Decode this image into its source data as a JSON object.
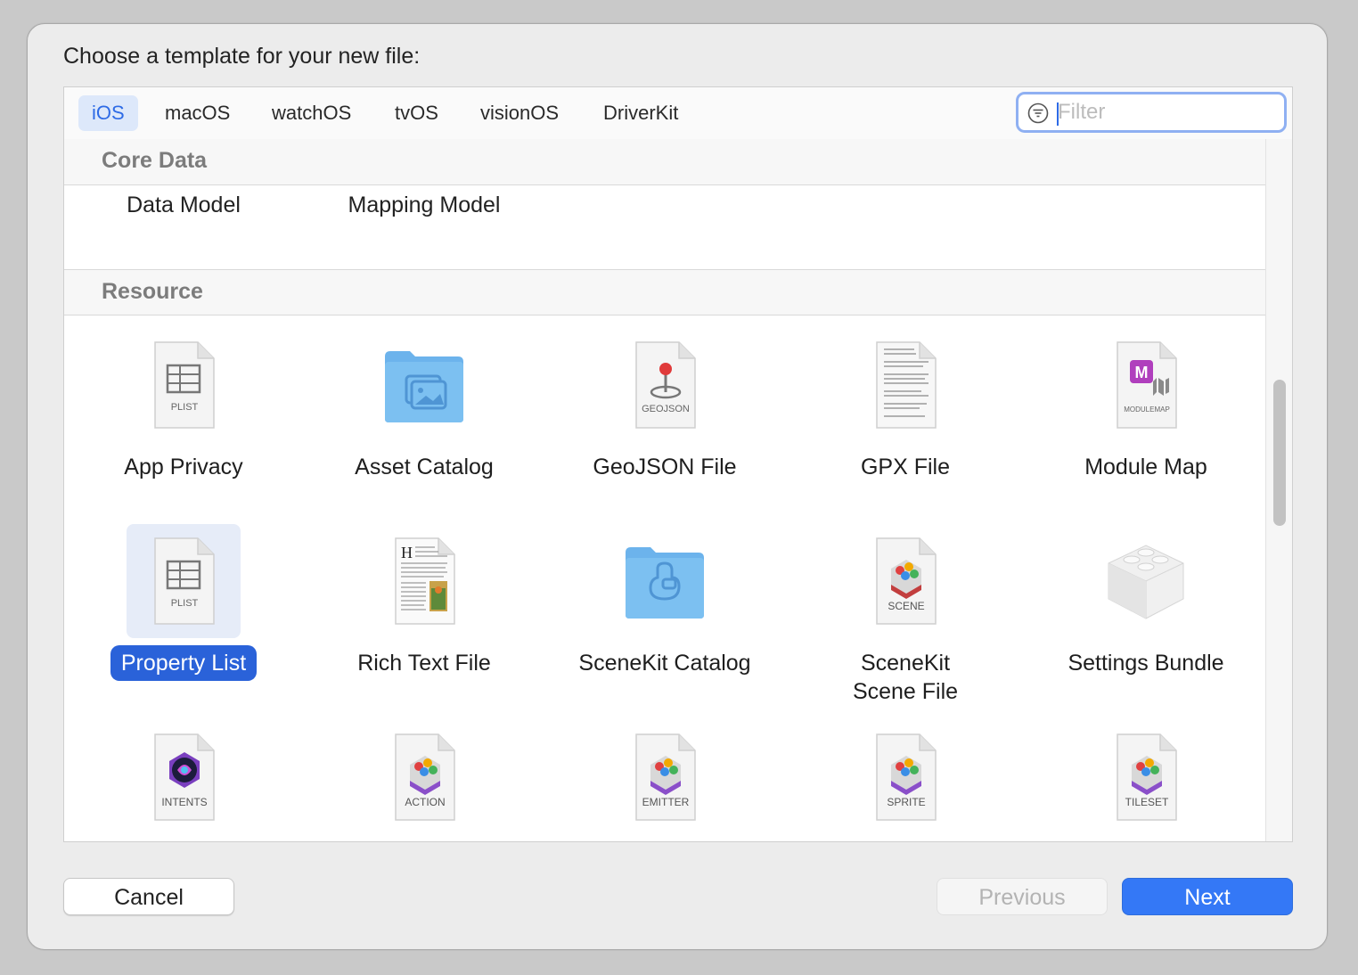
{
  "dialog": {
    "title": "Choose a template for your new file:"
  },
  "tabs": [
    {
      "label": "iOS",
      "active": true
    },
    {
      "label": "macOS"
    },
    {
      "label": "watchOS"
    },
    {
      "label": "tvOS"
    },
    {
      "label": "visionOS"
    },
    {
      "label": "DriverKit"
    }
  ],
  "filter": {
    "placeholder": "Filter",
    "value": ""
  },
  "sections": {
    "core_data": {
      "title": "Core Data",
      "items": [
        "Data Model",
        "Mapping Model"
      ]
    },
    "resource": {
      "title": "Resource",
      "items": [
        {
          "label": "App Privacy",
          "icon": "plist-file-icon",
          "badge": "PLIST"
        },
        {
          "label": "Asset Catalog",
          "icon": "asset-folder-icon"
        },
        {
          "label": "GeoJSON File",
          "icon": "geojson-file-icon",
          "badge": "GEOJSON"
        },
        {
          "label": "GPX File",
          "icon": "gpx-file-icon"
        },
        {
          "label": "Module Map",
          "icon": "modulemap-file-icon",
          "badge": "MODULEMAP"
        },
        {
          "label": "Property List",
          "icon": "plist-file-icon",
          "badge": "PLIST",
          "selected": true
        },
        {
          "label": "Rich Text File",
          "icon": "rich-text-file-icon"
        },
        {
          "label": "SceneKit Catalog",
          "icon": "scenekit-folder-icon"
        },
        {
          "label": "SceneKit\nScene File",
          "icon": "scene-file-icon",
          "badge": "SCENE"
        },
        {
          "label": "Settings Bundle",
          "icon": "settings-bundle-icon"
        },
        {
          "label": "",
          "icon": "intents-file-icon",
          "badge": "INTENTS"
        },
        {
          "label": "",
          "icon": "action-file-icon",
          "badge": "ACTION"
        },
        {
          "label": "",
          "icon": "emitter-file-icon",
          "badge": "EMITTER"
        },
        {
          "label": "",
          "icon": "sprite-file-icon",
          "badge": "SPRITE"
        },
        {
          "label": "",
          "icon": "tileset-file-icon",
          "badge": "TILESET"
        }
      ]
    }
  },
  "buttons": {
    "cancel": "Cancel",
    "previous": "Previous",
    "next": "Next"
  },
  "colors": {
    "accent": "#3478f6",
    "selection": "#2a62d9",
    "folder": "#6cb3ec"
  }
}
